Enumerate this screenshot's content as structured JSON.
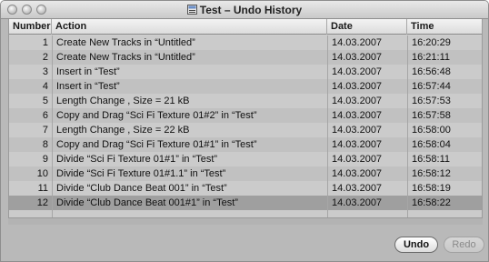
{
  "window": {
    "title": "Test – Undo History"
  },
  "table": {
    "columns": {
      "number": "Number",
      "action": "Action",
      "date": "Date",
      "time": "Time"
    },
    "rows": [
      {
        "number": "1",
        "action": "Create New Tracks in “Untitled”",
        "date": "14.03.2007",
        "time": "16:20:29"
      },
      {
        "number": "2",
        "action": "Create New Tracks in “Untitled”",
        "date": "14.03.2007",
        "time": "16:21:11"
      },
      {
        "number": "3",
        "action": "Insert in “Test”",
        "date": "14.03.2007",
        "time": "16:56:48"
      },
      {
        "number": "4",
        "action": "Insert in “Test”",
        "date": "14.03.2007",
        "time": "16:57:44"
      },
      {
        "number": "5",
        "action": "Length Change , Size = 21 kB",
        "date": "14.03.2007",
        "time": "16:57:53"
      },
      {
        "number": "6",
        "action": "Copy and Drag “Sci Fi Texture 01#2” in “Test”",
        "date": "14.03.2007",
        "time": "16:57:58"
      },
      {
        "number": "7",
        "action": "Length Change , Size = 22 kB",
        "date": "14.03.2007",
        "time": "16:58:00"
      },
      {
        "number": "8",
        "action": "Copy and Drag “Sci Fi Texture 01#1” in “Test”",
        "date": "14.03.2007",
        "time": "16:58:04"
      },
      {
        "number": "9",
        "action": "Divide “Sci Fi Texture 01#1” in “Test”",
        "date": "14.03.2007",
        "time": "16:58:11"
      },
      {
        "number": "10",
        "action": "Divide “Sci Fi Texture 01#1.1” in “Test”",
        "date": "14.03.2007",
        "time": "16:58:12"
      },
      {
        "number": "11",
        "action": "Divide “Club Dance Beat 001” in “Test”",
        "date": "14.03.2007",
        "time": "16:58:19"
      },
      {
        "number": "12",
        "action": "Divide “Club Dance Beat 001#1” in “Test”",
        "date": "14.03.2007",
        "time": "16:58:22"
      }
    ],
    "selected_row": "12"
  },
  "buttons": {
    "undo": "Undo",
    "redo": "Redo"
  }
}
